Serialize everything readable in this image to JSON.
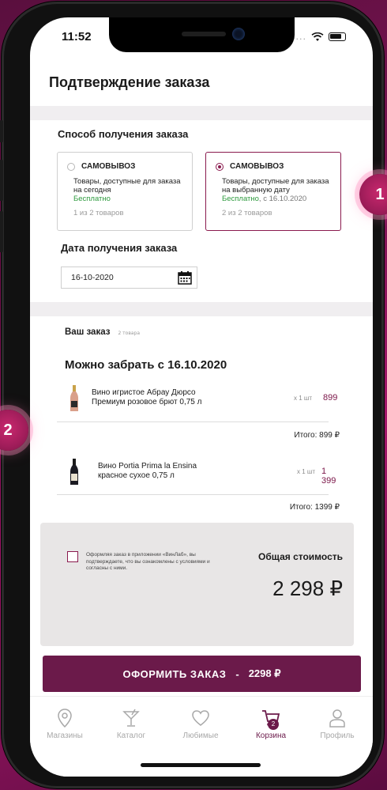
{
  "status": {
    "time": "11:52"
  },
  "page": {
    "title": "Подтверждение заказа"
  },
  "delivery": {
    "section_title": "Способ получения заказа",
    "options": [
      {
        "label": "САМОВЫВОЗ",
        "desc": "Товары, доступные для заказа на сегодня",
        "free": "Бесплатно",
        "date": "",
        "count": "1 из 2 товаров",
        "selected": false
      },
      {
        "label": "САМОВЫВОЗ",
        "desc": "Товары, доступные для заказа на выбранную дату",
        "free": "Бесплатно",
        "date": ", с 16.10.2020",
        "count": "2 из 2 товаров",
        "selected": true
      }
    ],
    "date_title": "Дата получения заказа",
    "date_value": "16-10-2020"
  },
  "order": {
    "title": "Ваш заказ",
    "count": "2 товара",
    "pickup_title": "Можно забрать с 16.10.2020",
    "items": [
      {
        "name_line1": "Вино игристое Абрау Дюрсо",
        "name_line2": "Премиум розовое брют 0,75 л",
        "qty": "x 1 шт",
        "price": "899",
        "subtotal": "Итого: 899 ₽"
      },
      {
        "name_line1": "Вино Portia Prima la Ensina",
        "name_line2": "красное сухое 0,75 л",
        "qty": "x 1 шт",
        "price": "1 399",
        "subtotal": "Итого: 1399 ₽"
      }
    ]
  },
  "summary": {
    "agreement": "Оформляя заказ в приложении «ВинЛаб», вы подтверждаете, что вы ознакомлены с условиями и согласны с ними.",
    "total_label": "Общая стоимость",
    "total_value": "2 298 ₽"
  },
  "submit": {
    "label": "ОФОРМИТЬ ЗАКАЗ",
    "dash": "-",
    "price": "2298 ₽"
  },
  "tabs": [
    {
      "label": "Магазины",
      "icon": "location-pin-icon",
      "active": false
    },
    {
      "label": "Каталог",
      "icon": "cocktail-glass-icon",
      "active": false
    },
    {
      "label": "Любимые",
      "icon": "heart-icon",
      "active": false
    },
    {
      "label": "Корзина",
      "icon": "cart-icon",
      "active": true,
      "badge": "2"
    },
    {
      "label": "Профиль",
      "icon": "person-icon",
      "active": false
    }
  ],
  "markers": [
    "1",
    "2"
  ],
  "colors": {
    "accent": "#6b1a4a",
    "background": "#7a1352",
    "free_green": "#2e9a3e"
  }
}
